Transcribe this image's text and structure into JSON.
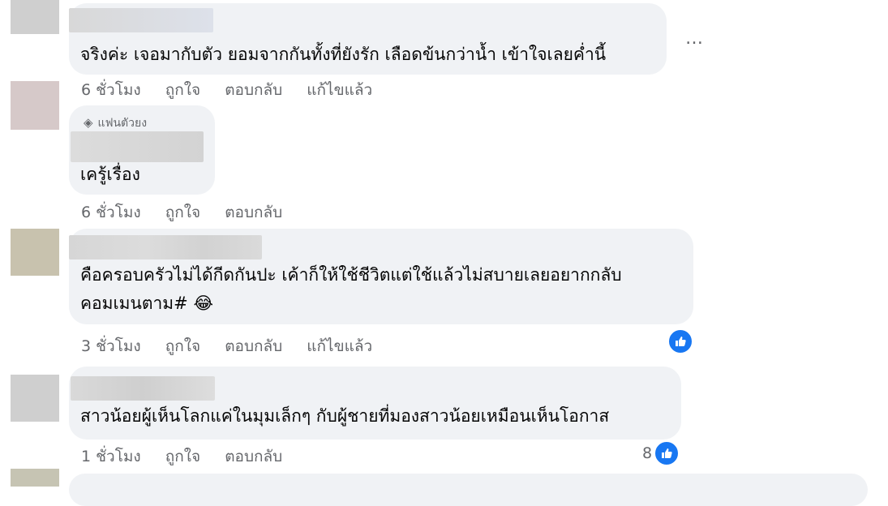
{
  "comments": [
    {
      "text": "จริงค่ะ เจอมากับตัว ยอมจากกันทั้งที่ยังรัก เลือดข้นกว่าน้ำ เข้าใจเลยค่ำนี้",
      "time": "6 ชั่วโมง",
      "like": "ถูกใจ",
      "reply": "ตอบกลับ",
      "edited": "แก้ไขแล้ว",
      "more_icon": "…"
    },
    {
      "badge": "แฟนตัวยง",
      "text": "เครู้เรื่อง",
      "time": "6 ชั่วโมง",
      "like": "ถูกใจ",
      "reply": "ตอบกลับ"
    },
    {
      "text_line1": "คือครอบครัวไม่ได้กีดกันปะ เค้าก็ให้ใช้ชีวิตแต่ใช้แล้วไม่สบายเลยอยากกลับ",
      "text_line2": "คอมเมนตาม#",
      "emoji": "😂",
      "time": "3 ชั่วโมง",
      "like": "ถูกใจ",
      "reply": "ตอบกลับ",
      "edited": "แก้ไขแล้ว",
      "reaction_icon": "like-icon"
    },
    {
      "text": "สาวน้อยผู้เห็นโลกแค่ในมุมเล็กๆ กับผู้ชายที่มองสาวน้อยเหมือนเห็นโอกาส",
      "time": "1 ชั่วโมง",
      "like": "ถูกใจ",
      "reply": "ตอบกลับ",
      "reaction_count": "8",
      "reaction_icon": "like-icon"
    }
  ],
  "colors": {
    "bubble": "#f0f2f5",
    "meta": "#65676b",
    "like_blue": "#1877f2"
  }
}
